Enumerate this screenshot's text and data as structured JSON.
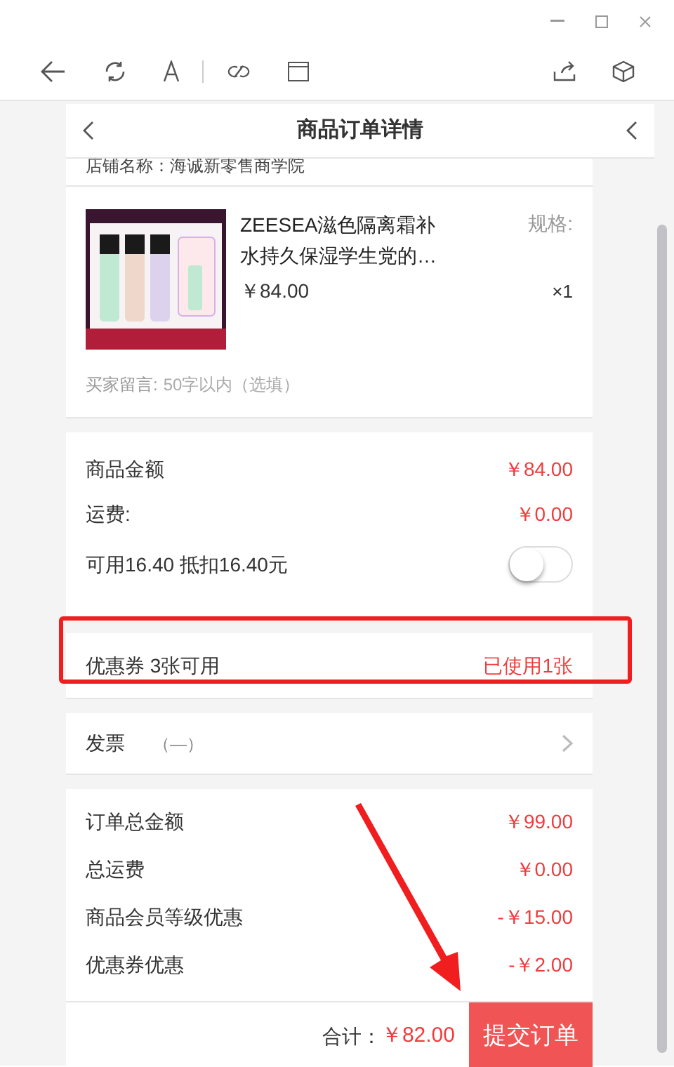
{
  "header": {
    "title": "商品订单详情"
  },
  "store": {
    "text": "店铺名称：海诚新零售商学院"
  },
  "product": {
    "name": "ZEESEA滋色隔离霜补水持久保湿学生党的…",
    "spec_label": "规格:",
    "price": "￥84.00",
    "quantity": "×1"
  },
  "message": {
    "label": "买家留言:",
    "placeholder": "50字以内（选填）"
  },
  "amounts": [
    {
      "label": "商品金额",
      "value": "￥84.00"
    },
    {
      "label": "运费:",
      "value": "￥0.00"
    }
  ],
  "points": {
    "label": "可用16.40 抵扣16.40元",
    "on": false
  },
  "coupon": {
    "label": "优惠券 3张可用",
    "value": "已使用1张",
    "highlighted": true
  },
  "invoice": {
    "label": "发票",
    "value": "（—）"
  },
  "summary": [
    {
      "label": "订单总金额",
      "value": "￥99.00"
    },
    {
      "label": "总运费",
      "value": "￥0.00"
    },
    {
      "label": "商品会员等级优惠",
      "value": "-￥15.00"
    },
    {
      "label": "优惠券优惠",
      "value": "-￥2.00"
    }
  ],
  "footer": {
    "total_label": "合计：",
    "total": "￥82.00",
    "submit": "提交订单"
  }
}
